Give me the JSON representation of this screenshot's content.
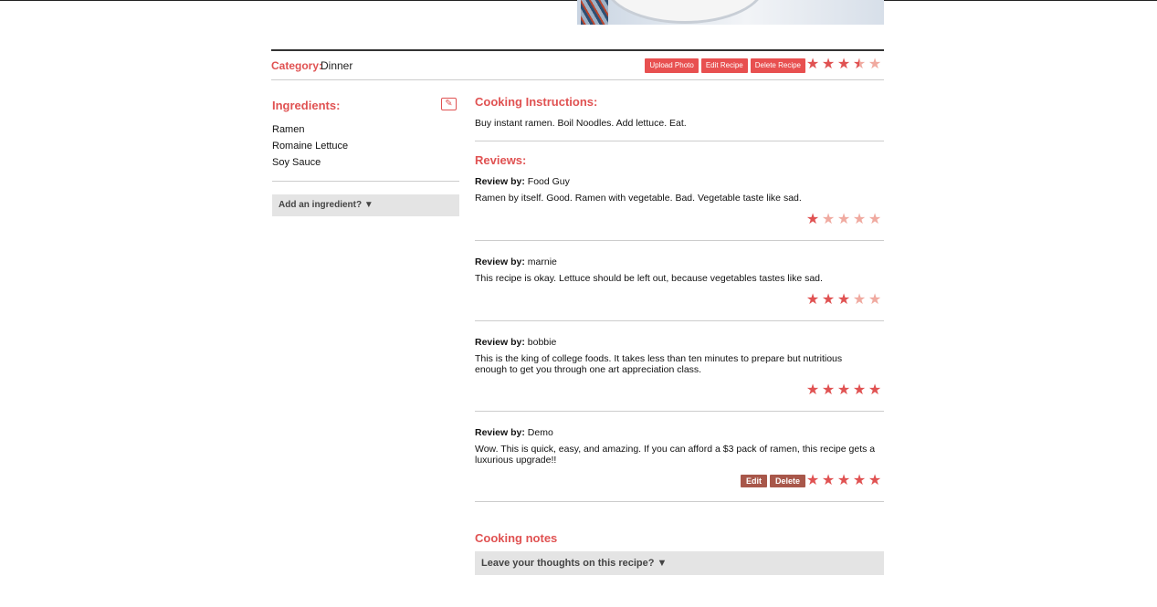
{
  "header": {
    "category_label": "Category:",
    "category_value": "Dinner",
    "buttons": {
      "upload_photo": "Upload Photo",
      "edit_recipe": "Edit Recipe",
      "delete_recipe": "Delete Recipe"
    },
    "rating": 3.5
  },
  "ingredients": {
    "title": "Ingredients:",
    "edit_icon": "pencil-icon",
    "items": [
      "Ramen",
      "Romaine Lettuce",
      "Soy Sauce"
    ],
    "add_label": "Add an ingredient? ▼"
  },
  "instructions": {
    "title": "Cooking Instructions:",
    "text": "Buy instant ramen. Boil Noodles. Add lettuce. Eat."
  },
  "reviews": {
    "title": "Reviews:",
    "by_label": "Review by:",
    "items": [
      {
        "author": "Food Guy",
        "text": "Ramen by itself. Good. Ramen with vegetable. Bad. Vegetable taste like sad.",
        "rating": 1
      },
      {
        "author": "marnie",
        "text": "This recipe is okay. Lettuce should be left out, because vegetables tastes like sad.",
        "rating": 3
      },
      {
        "author": "bobbie",
        "text": "This is the king of college foods. It takes less than ten minutes to prepare but nutritious enough to get you through one art appreciation class.",
        "rating": 5
      },
      {
        "author": "Demo",
        "text": "Wow. This is quick, easy, and amazing. If you can afford a $3 pack of ramen, this recipe gets a luxurious upgrade!!",
        "rating": 5,
        "edit_label": "Edit",
        "delete_label": "Delete"
      }
    ]
  },
  "notes": {
    "title": "Cooking notes",
    "prompt": "Leave your thoughts on this recipe? ▼"
  },
  "colors": {
    "accent": "#e05252",
    "button": "#e85050",
    "button_dark": "#a8574a",
    "star_empty": "#f0aaa0"
  }
}
